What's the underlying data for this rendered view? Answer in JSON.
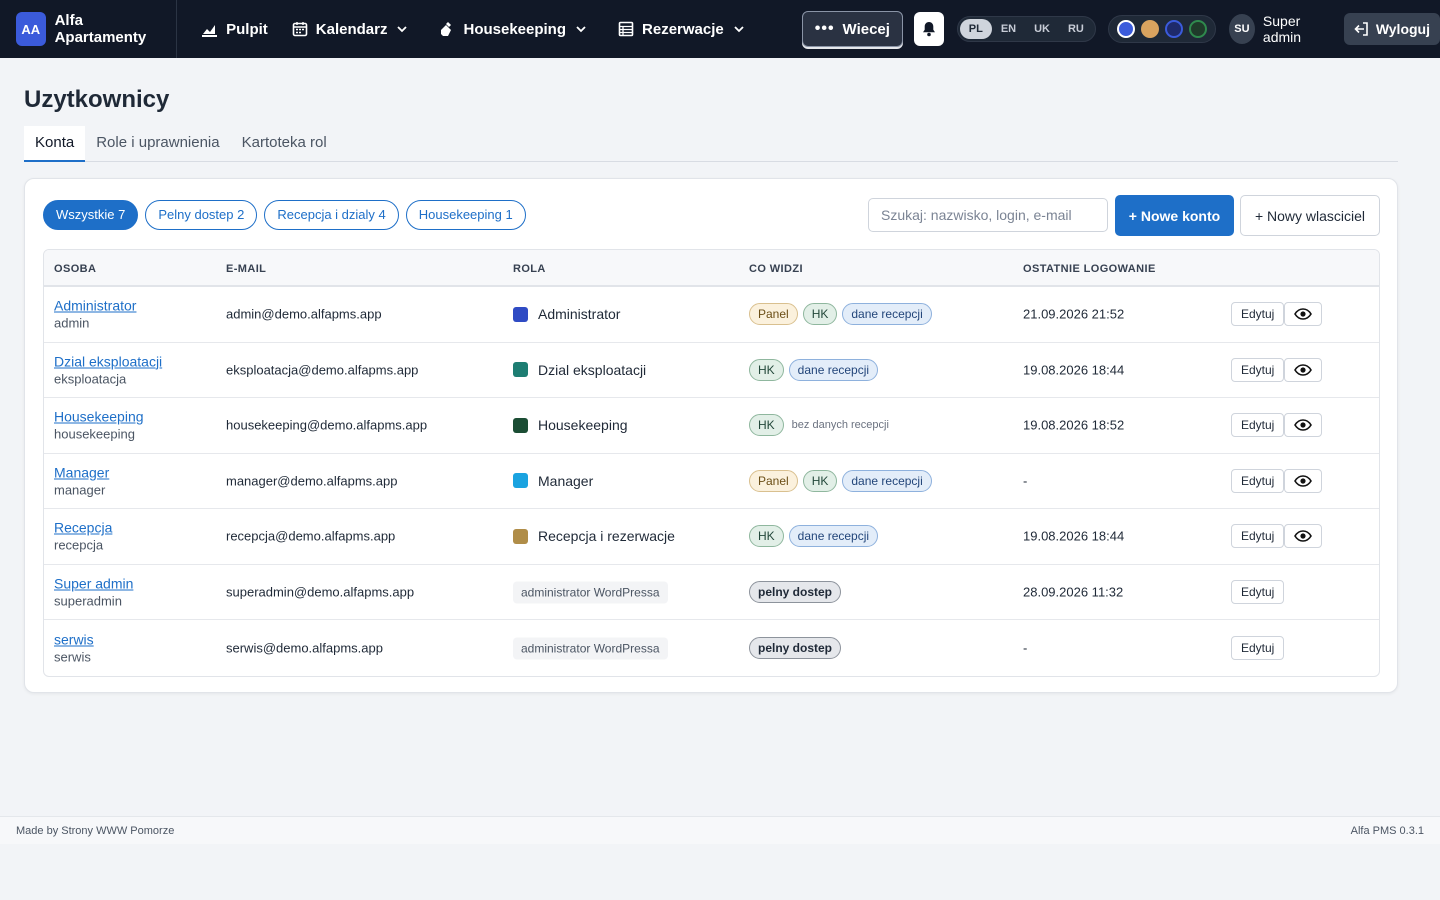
{
  "brand": {
    "initials": "AA",
    "name": "Alfa Apartamenty"
  },
  "nav": {
    "items": [
      {
        "label": "Pulpit",
        "icon": "chart-icon"
      },
      {
        "label": "Kalendarz",
        "icon": "calendar-icon"
      },
      {
        "label": "Housekeeping",
        "icon": "broom-icon"
      },
      {
        "label": "Rezerwacje",
        "icon": "list-icon"
      }
    ],
    "more_label": "Wiecej"
  },
  "languages": [
    "PL",
    "EN",
    "UK",
    "RU"
  ],
  "active_language": "PL",
  "themes": [
    {
      "color": "#3b5bdb"
    },
    {
      "color": "#d9a35f"
    },
    {
      "color": "#1e2a6b"
    },
    {
      "color": "#1f3b2a"
    }
  ],
  "user": {
    "initials": "SU",
    "name": "Super admin",
    "logout_label": "Wyloguj"
  },
  "page": {
    "title": "Uzytkownicy"
  },
  "tabs": [
    "Konta",
    "Role i uprawnienia",
    "Kartoteka rol"
  ],
  "filters": [
    "Wszystkie 7",
    "Pelny dostep 2",
    "Recepcja i dzialy 4",
    "Housekeeping 1"
  ],
  "search": {
    "placeholder": "Szukaj: nazwisko, login, e-mail"
  },
  "actions": {
    "new_account": "+ Nowe konto",
    "new_owner": "+ Nowy wlasciciel"
  },
  "table": {
    "headers": [
      "OSOBA",
      "E-MAIL",
      "ROLA",
      "CO WIDZI",
      "OSTATNIE LOGOWANIE"
    ],
    "edit_label": "Edytuj",
    "rows": [
      {
        "name": "Administrator",
        "login": "admin",
        "email": "admin@demo.alfapms.app",
        "role": "Administrator",
        "role_color": "#2f4bc4",
        "panel": "Panel",
        "hk": "HK",
        "rec": "dane recepcji",
        "last": "21.09.2026 21:52"
      },
      {
        "name": "Dzial eksploatacji",
        "login": "eksploatacja",
        "email": "eksploatacja@demo.alfapms.app",
        "role": "Dzial eksploatacji",
        "role_color": "#1d7d72",
        "hk": "HK",
        "rec": "dane recepcji",
        "last": "19.08.2026 18:44"
      },
      {
        "name": "Housekeeping",
        "login": "housekeeping",
        "email": "housekeeping@demo.alfapms.app",
        "role": "Housekeeping",
        "role_color": "#1b4d34",
        "hk": "HK",
        "none": "bez danych recepcji",
        "last": "19.08.2026 18:52"
      },
      {
        "name": "Manager",
        "login": "manager",
        "email": "manager@demo.alfapms.app",
        "role": "Manager",
        "role_color": "#1aa3e0",
        "panel": "Panel",
        "hk": "HK",
        "rec": "dane recepcji",
        "last": "-"
      },
      {
        "name": "Recepcja",
        "login": "recepcja",
        "email": "recepcja@demo.alfapms.app",
        "role": "Recepcja i rezerwacje",
        "role_color": "#b08d48",
        "hk": "HK",
        "rec": "dane recepcji",
        "last": "19.08.2026 18:44"
      },
      {
        "name": "Super admin",
        "login": "superadmin",
        "email": "superadmin@demo.alfapms.app",
        "role_wp": "administrator WordPressa",
        "full": "pelny dostep",
        "last": "28.09.2026 11:32"
      },
      {
        "name": "serwis",
        "login": "serwis",
        "email": "serwis@demo.alfapms.app",
        "role_wp": "administrator WordPressa",
        "full": "pelny dostep",
        "last": "-"
      }
    ]
  },
  "footer": {
    "left": "Made by Strony WWW Pomorze",
    "right": "Alfa PMS 0.3.1"
  }
}
